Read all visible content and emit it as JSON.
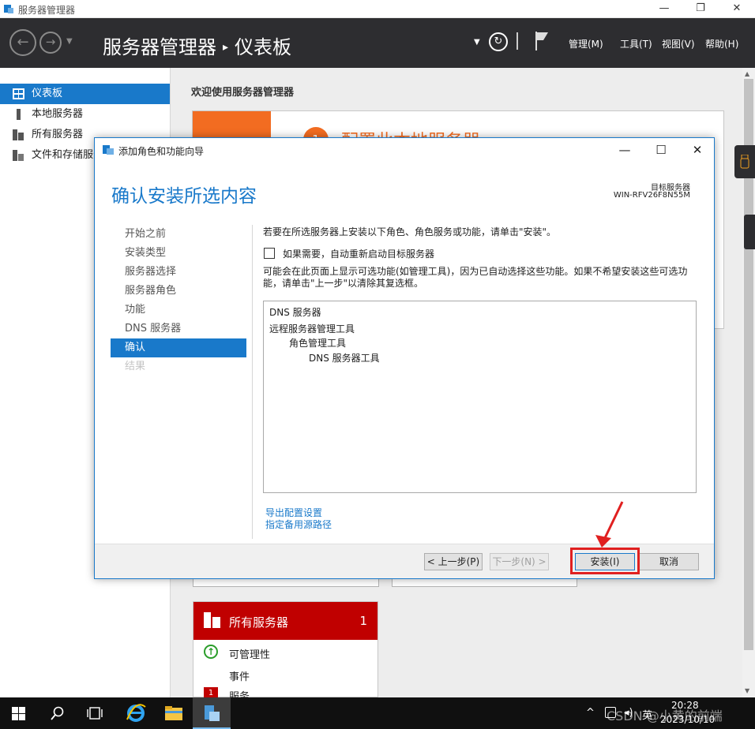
{
  "window": {
    "title": "服务器管理器",
    "minimize_icon": "—",
    "restore_icon": "❐",
    "close_icon": "✕"
  },
  "header": {
    "breadcrumb_app": "服务器管理器",
    "breadcrumb_page": "仪表板",
    "menus": [
      "管理(M)",
      "工具(T)",
      "视图(V)",
      "帮助(H)"
    ]
  },
  "sidebar": {
    "items": [
      {
        "label": "仪表板",
        "icon": "dashboard-icon",
        "active": true
      },
      {
        "label": "本地服务器",
        "icon": "server-icon"
      },
      {
        "label": "所有服务器",
        "icon": "servers-icon"
      },
      {
        "label": "文件和存储服务",
        "icon": "storage-icon"
      }
    ]
  },
  "main": {
    "welcome": "欢迎使用服务器管理器",
    "quickstart_number": "1",
    "quickstart_text": "配置此本地服务器",
    "tile": {
      "name": "所有服务器",
      "count": "1",
      "rows": [
        "可管理性",
        "事件",
        "服务"
      ],
      "service_badge": "1"
    }
  },
  "dialog": {
    "title": "添加角色和功能向导",
    "heading": "确认安装所选内容",
    "target_label": "目标服务器",
    "target_value": "WIN-RFV26F8N55M",
    "steps": [
      {
        "label": "开始之前",
        "state": "normal"
      },
      {
        "label": "安装类型",
        "state": "normal"
      },
      {
        "label": "服务器选择",
        "state": "normal"
      },
      {
        "label": "服务器角色",
        "state": "normal"
      },
      {
        "label": "功能",
        "state": "normal"
      },
      {
        "label": "DNS 服务器",
        "state": "normal"
      },
      {
        "label": "确认",
        "state": "active"
      },
      {
        "label": "结果",
        "state": "disabled"
      }
    ],
    "instruction": "若要在所选服务器上安装以下角色、角色服务或功能，请单击\"安装\"。",
    "restart_checkbox_label": "如果需要，自动重新启动目标服务器",
    "restart_checked": false,
    "note": "可能会在此页面上显示可选功能(如管理工具)，因为已自动选择这些功能。如果不希望安装这些可选功能，请单击\"上一步\"以清除其复选框。",
    "selections": [
      {
        "label": "DNS 服务器",
        "level": 0
      },
      {
        "label": "远程服务器管理工具",
        "level": 0
      },
      {
        "label": "角色管理工具",
        "level": 1
      },
      {
        "label": "DNS 服务器工具",
        "level": 2
      }
    ],
    "links": [
      "导出配置设置",
      "指定备用源路径"
    ],
    "buttons": {
      "back": "< 上一步(P)",
      "next": "下一步(N) >",
      "install": "安装(I)",
      "cancel": "取消"
    }
  },
  "taskbar": {
    "tray_language": "英",
    "time": "20:28",
    "date": "2023/10/10",
    "watermark": "CSDN @小黄的前端"
  },
  "colors": {
    "accent": "#1979ca",
    "header_bg": "#2d2d30",
    "quickstart_orange": "#f26c21",
    "tile_red": "#c00000",
    "highlight_red": "#e02020"
  }
}
